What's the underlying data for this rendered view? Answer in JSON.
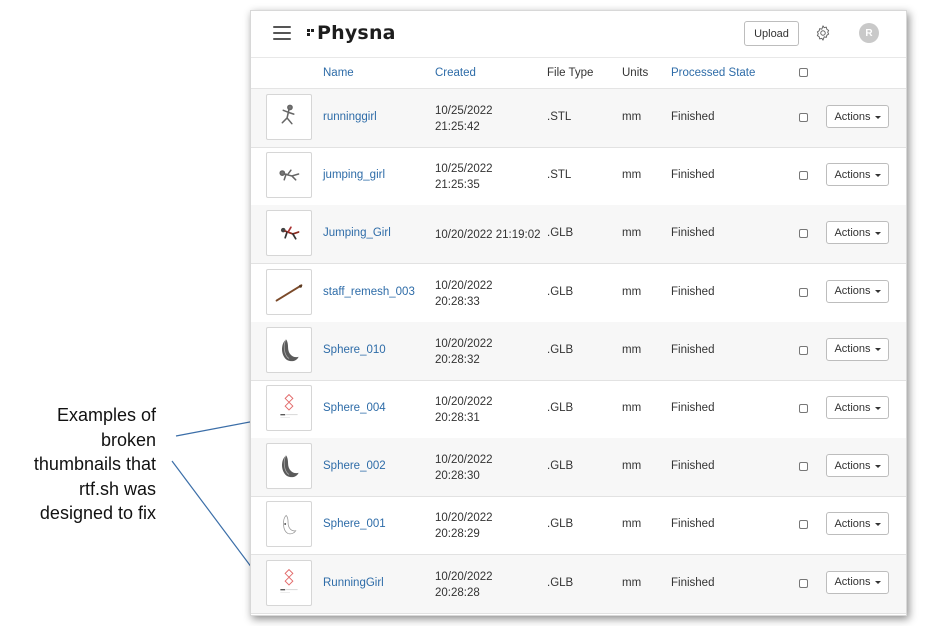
{
  "annotation": {
    "lines": [
      "Examples of",
      "broken",
      "thumbnails that",
      "rtf.sh was",
      "designed to fix"
    ]
  },
  "app": {
    "brand": "Physna",
    "upload_label": "Upload",
    "settings_icon": "gear-icon",
    "avatar_initial": "R"
  },
  "table": {
    "columns": {
      "name": "Name",
      "created": "Created",
      "file_type": "File Type",
      "units": "Units",
      "processed_state": "Processed State"
    },
    "rows": [
      {
        "name": "runninggirl",
        "created_date": "10/25/2022",
        "created_time": "21:25:42",
        "file_type": ".STL",
        "units": "mm",
        "state": "Finished",
        "actions": "Actions",
        "thumb": "running-figure"
      },
      {
        "name": "jumping_girl",
        "created_date": "10/25/2022",
        "created_time": "21:25:35",
        "file_type": ".STL",
        "units": "mm",
        "state": "Finished",
        "actions": "Actions",
        "thumb": "jumping-figure"
      },
      {
        "name": "Jumping_Girl",
        "created_date": "10/20/2022 21:19:02",
        "created_time": "",
        "file_type": ".GLB",
        "units": "mm",
        "state": "Finished",
        "actions": "Actions",
        "thumb": "jumping-figure-color"
      },
      {
        "name": "staff_remesh_003",
        "created_date": "10/20/2022",
        "created_time": "20:28:33",
        "file_type": ".GLB",
        "units": "mm",
        "state": "Finished",
        "actions": "Actions",
        "thumb": "staff"
      },
      {
        "name": "Sphere_010",
        "created_date": "10/20/2022",
        "created_time": "20:28:32",
        "file_type": ".GLB",
        "units": "mm",
        "state": "Finished",
        "actions": "Actions",
        "thumb": "sphere"
      },
      {
        "name": "Sphere_004",
        "created_date": "10/20/2022",
        "created_time": "20:28:31",
        "file_type": ".GLB",
        "units": "mm",
        "state": "Finished",
        "actions": "Actions",
        "thumb": "broken-placeholder"
      },
      {
        "name": "Sphere_002",
        "created_date": "10/20/2022",
        "created_time": "20:28:30",
        "file_type": ".GLB",
        "units": "mm",
        "state": "Finished",
        "actions": "Actions",
        "thumb": "sphere"
      },
      {
        "name": "Sphere_001",
        "created_date": "10/20/2022",
        "created_time": "20:28:29",
        "file_type": ".GLB",
        "units": "mm",
        "state": "Finished",
        "actions": "Actions",
        "thumb": "sphere-small"
      },
      {
        "name": "RunningGirl",
        "created_date": "10/20/2022",
        "created_time": "20:28:28",
        "file_type": ".GLB",
        "units": "mm",
        "state": "Finished",
        "actions": "Actions",
        "thumb": "broken-placeholder"
      }
    ]
  },
  "colors": {
    "link": "#2e6ca8",
    "arrow": "#3b6ea8"
  }
}
